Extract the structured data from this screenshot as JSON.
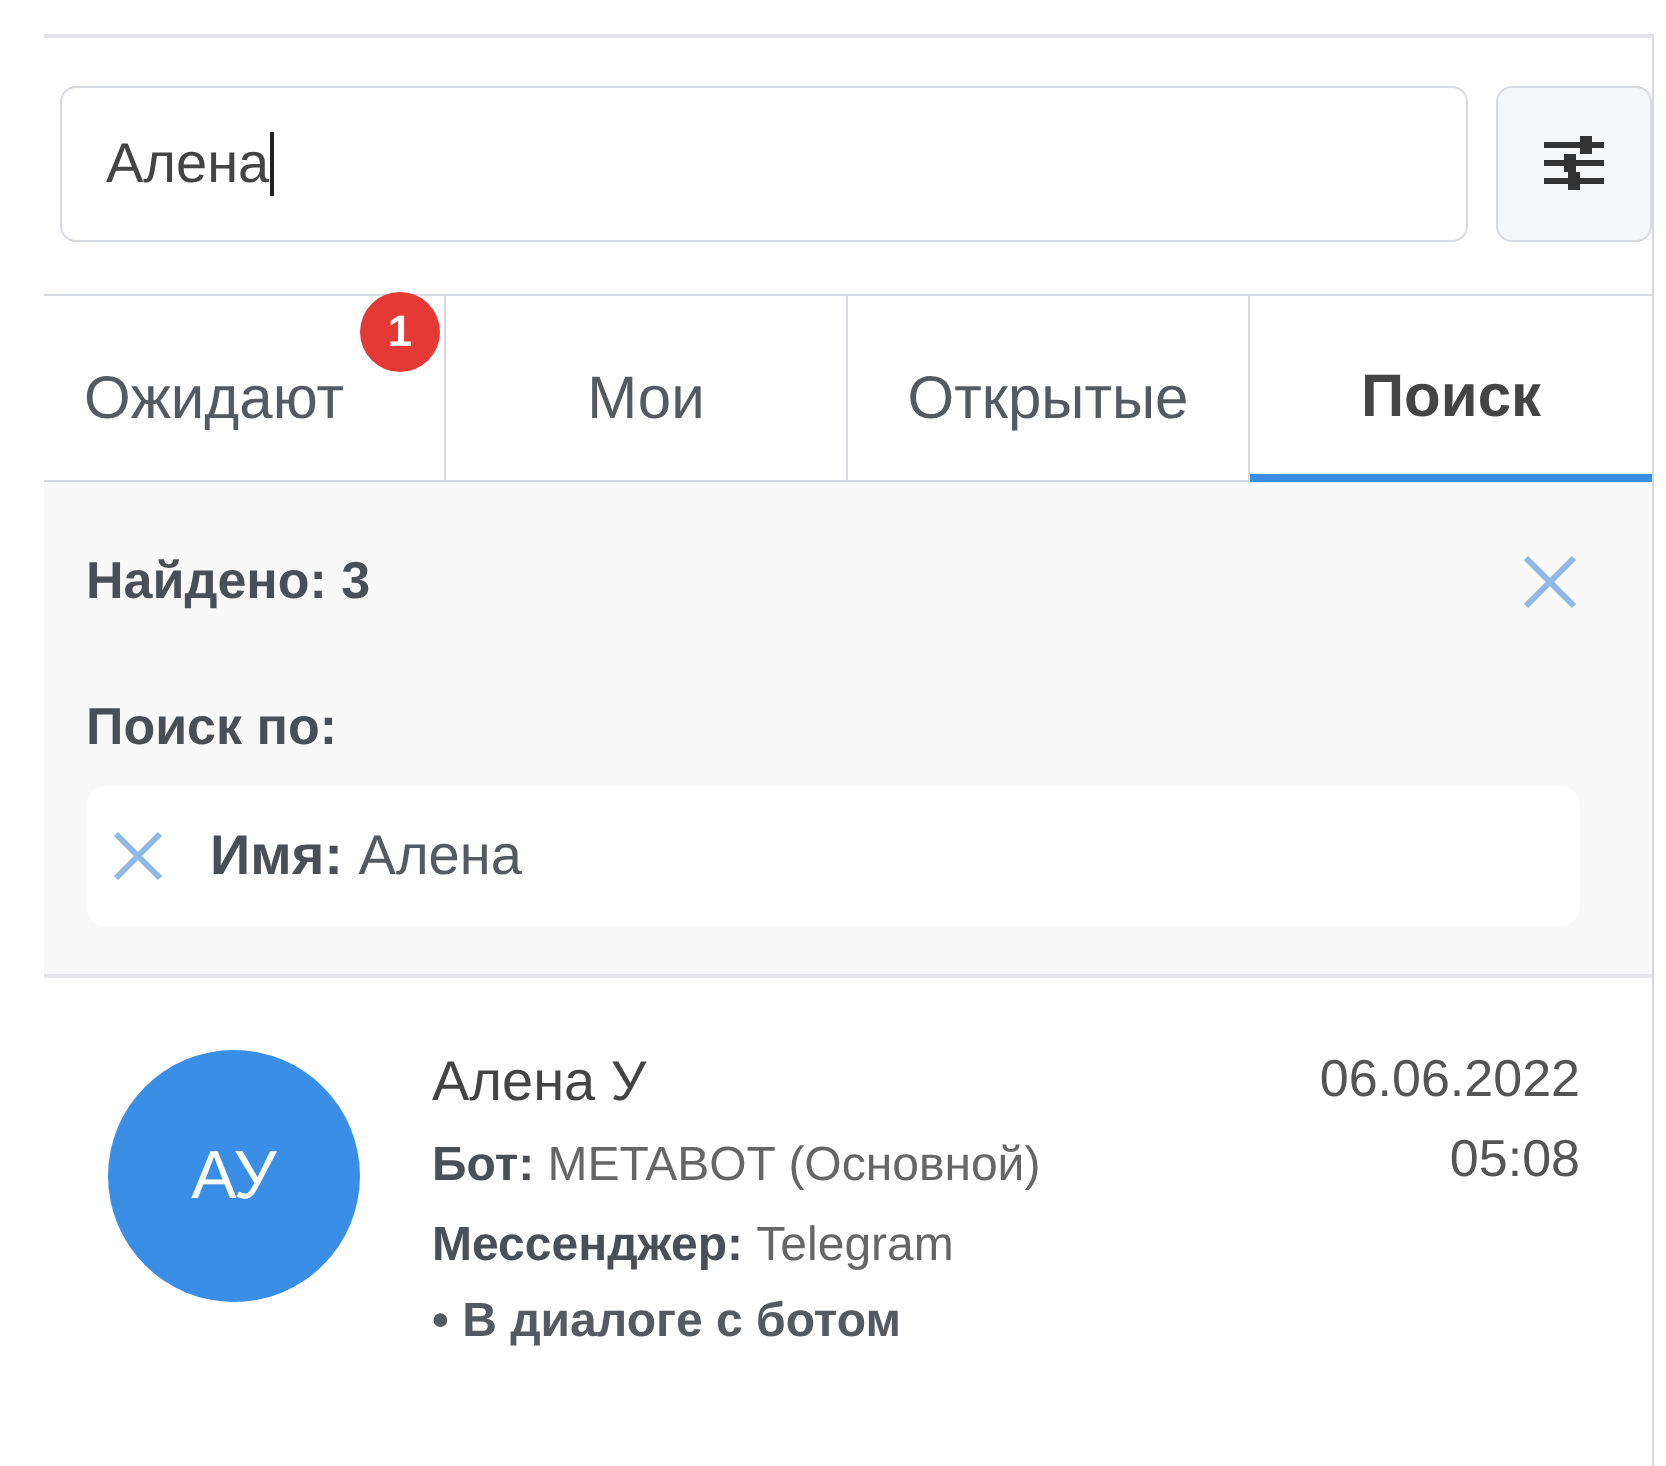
{
  "search": {
    "value": "Алена"
  },
  "tabs": [
    {
      "label": "Ожидают",
      "selected": false,
      "badge": "1"
    },
    {
      "label": "Мои",
      "selected": false
    },
    {
      "label": "Открытые",
      "selected": false
    },
    {
      "label": "Поиск",
      "selected": true
    }
  ],
  "results_panel": {
    "found": "Найдено: 3",
    "search_by": "Поиск по:",
    "filters": [
      {
        "text": "**Имя:** Алена"
      }
    ]
  },
  "results": [
    {
      "initials": "АУ",
      "name": "Алена У",
      "date": "06.06.2022",
      "time": "05:08",
      "details": [
        "**Бот:** METABOT (Основной)",
        "**Мессенджер:** Telegram"
      ],
      "status": "• В диалоге с ботом"
    }
  ]
}
